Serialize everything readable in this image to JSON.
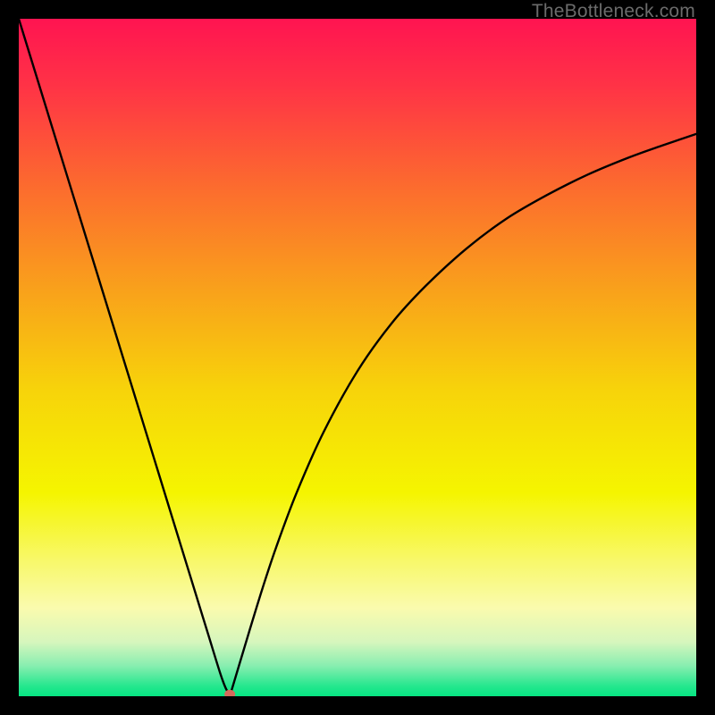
{
  "watermark": {
    "text": "TheBottleneck.com"
  },
  "chart_data": {
    "type": "line",
    "title": "",
    "xlabel": "",
    "ylabel": "",
    "xlim": [
      0,
      100
    ],
    "ylim": [
      0,
      100
    ],
    "grid": false,
    "legend": false,
    "background_gradient": {
      "stops": [
        {
          "pos": 0.0,
          "color": "#ff1451"
        },
        {
          "pos": 0.1,
          "color": "#ff3346"
        },
        {
          "pos": 0.25,
          "color": "#fc6c2e"
        },
        {
          "pos": 0.4,
          "color": "#f9a11b"
        },
        {
          "pos": 0.55,
          "color": "#f7d40a"
        },
        {
          "pos": 0.7,
          "color": "#f5f500"
        },
        {
          "pos": 0.8,
          "color": "#f8f86a"
        },
        {
          "pos": 0.87,
          "color": "#fafbae"
        },
        {
          "pos": 0.92,
          "color": "#d6f6bd"
        },
        {
          "pos": 0.955,
          "color": "#88eeb0"
        },
        {
          "pos": 0.985,
          "color": "#25e78e"
        },
        {
          "pos": 1.0,
          "color": "#06e582"
        }
      ]
    },
    "series": [
      {
        "name": "bottleneck-curve",
        "x": [
          0,
          2,
          4,
          6,
          8,
          10,
          12,
          14,
          16,
          18,
          20,
          22,
          24,
          26,
          28,
          29.7,
          30.5,
          31,
          31.3,
          31.6,
          32.5,
          34,
          36,
          38,
          41,
          45,
          50,
          55,
          60,
          66,
          72,
          78,
          84,
          90,
          95,
          100
        ],
        "y": [
          100,
          93.5,
          87,
          80.5,
          74,
          67.5,
          61,
          54.5,
          48,
          41.5,
          35,
          28.5,
          22,
          15.5,
          9,
          3.5,
          1.3,
          0.5,
          0.6,
          1.5,
          4.5,
          9.5,
          16,
          22,
          30,
          39,
          48,
          55,
          60.5,
          66,
          70.5,
          74,
          77,
          79.5,
          81.3,
          83
        ]
      }
    ],
    "marker": {
      "x": 31.15,
      "y": 0.3,
      "color": "#d56a5c",
      "rx": 6,
      "ry": 5
    }
  }
}
